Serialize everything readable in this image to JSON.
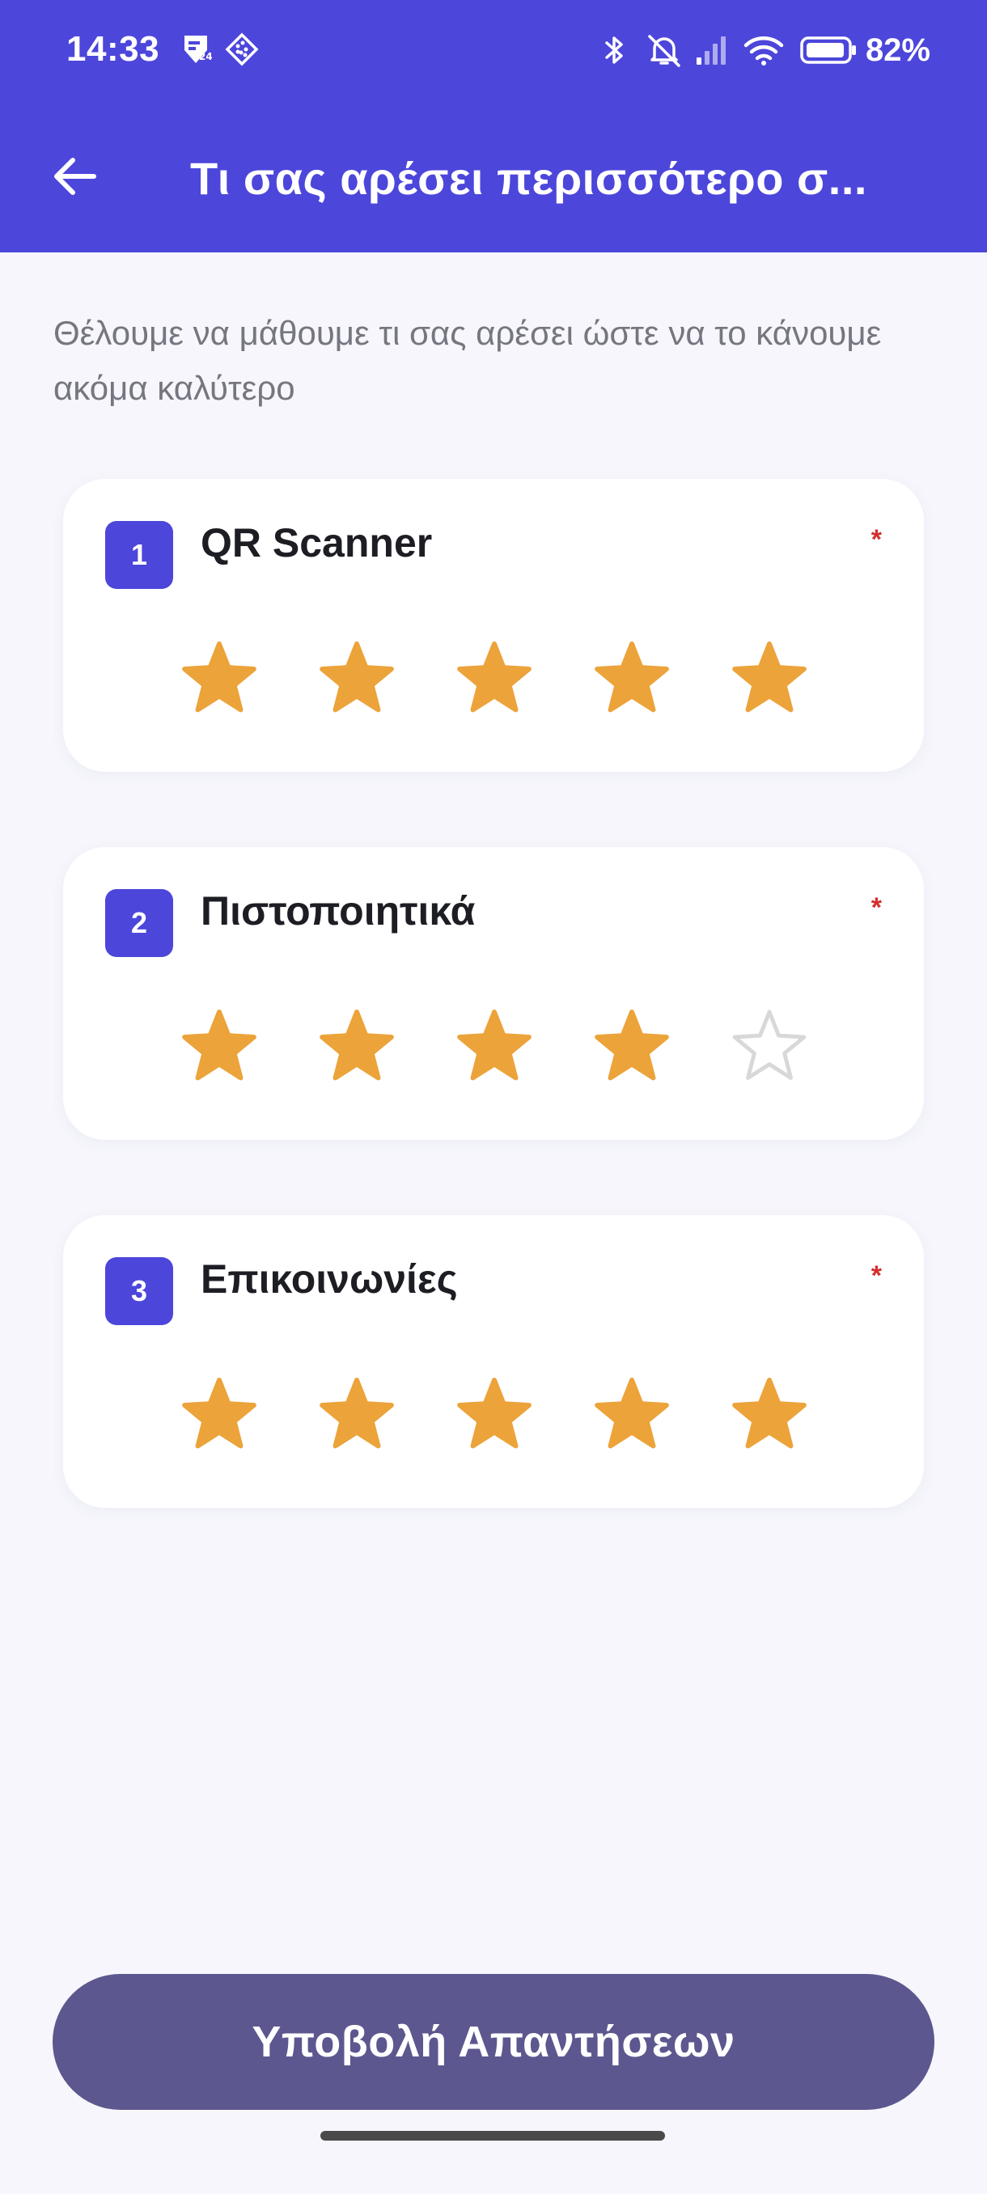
{
  "status_bar": {
    "time": "14:33",
    "battery_percent": "82%",
    "icons": [
      "notification-badge-icon",
      "app-grid-icon",
      "bluetooth-icon",
      "mute-bell-icon",
      "signal-icon",
      "wifi-icon",
      "battery-icon"
    ]
  },
  "header": {
    "back_icon": "arrow-left-icon",
    "title": "Τι σας αρέσει περισσότερο σ..."
  },
  "intro_text": "Θέλουμε να μάθουμε τι σας αρέσει ώστε να το κάνουμε ακόμα καλύτερο",
  "colors": {
    "primary": "#4c46db",
    "star_filled": "#eca33a",
    "star_empty": "#d8d8d8",
    "required": "#d32f2f",
    "submit": "#5c578e"
  },
  "questions": [
    {
      "number": "1",
      "title": "QR Scanner",
      "required_mark": "*",
      "rating": 5,
      "max_rating": 5
    },
    {
      "number": "2",
      "title": "Πιστοποιητικά",
      "required_mark": "*",
      "rating": 4,
      "max_rating": 5
    },
    {
      "number": "3",
      "title": "Επικοινωνίες",
      "required_mark": "*",
      "rating": 5,
      "max_rating": 5
    }
  ],
  "submit_label": "Υποβολή Απαντήσεων"
}
